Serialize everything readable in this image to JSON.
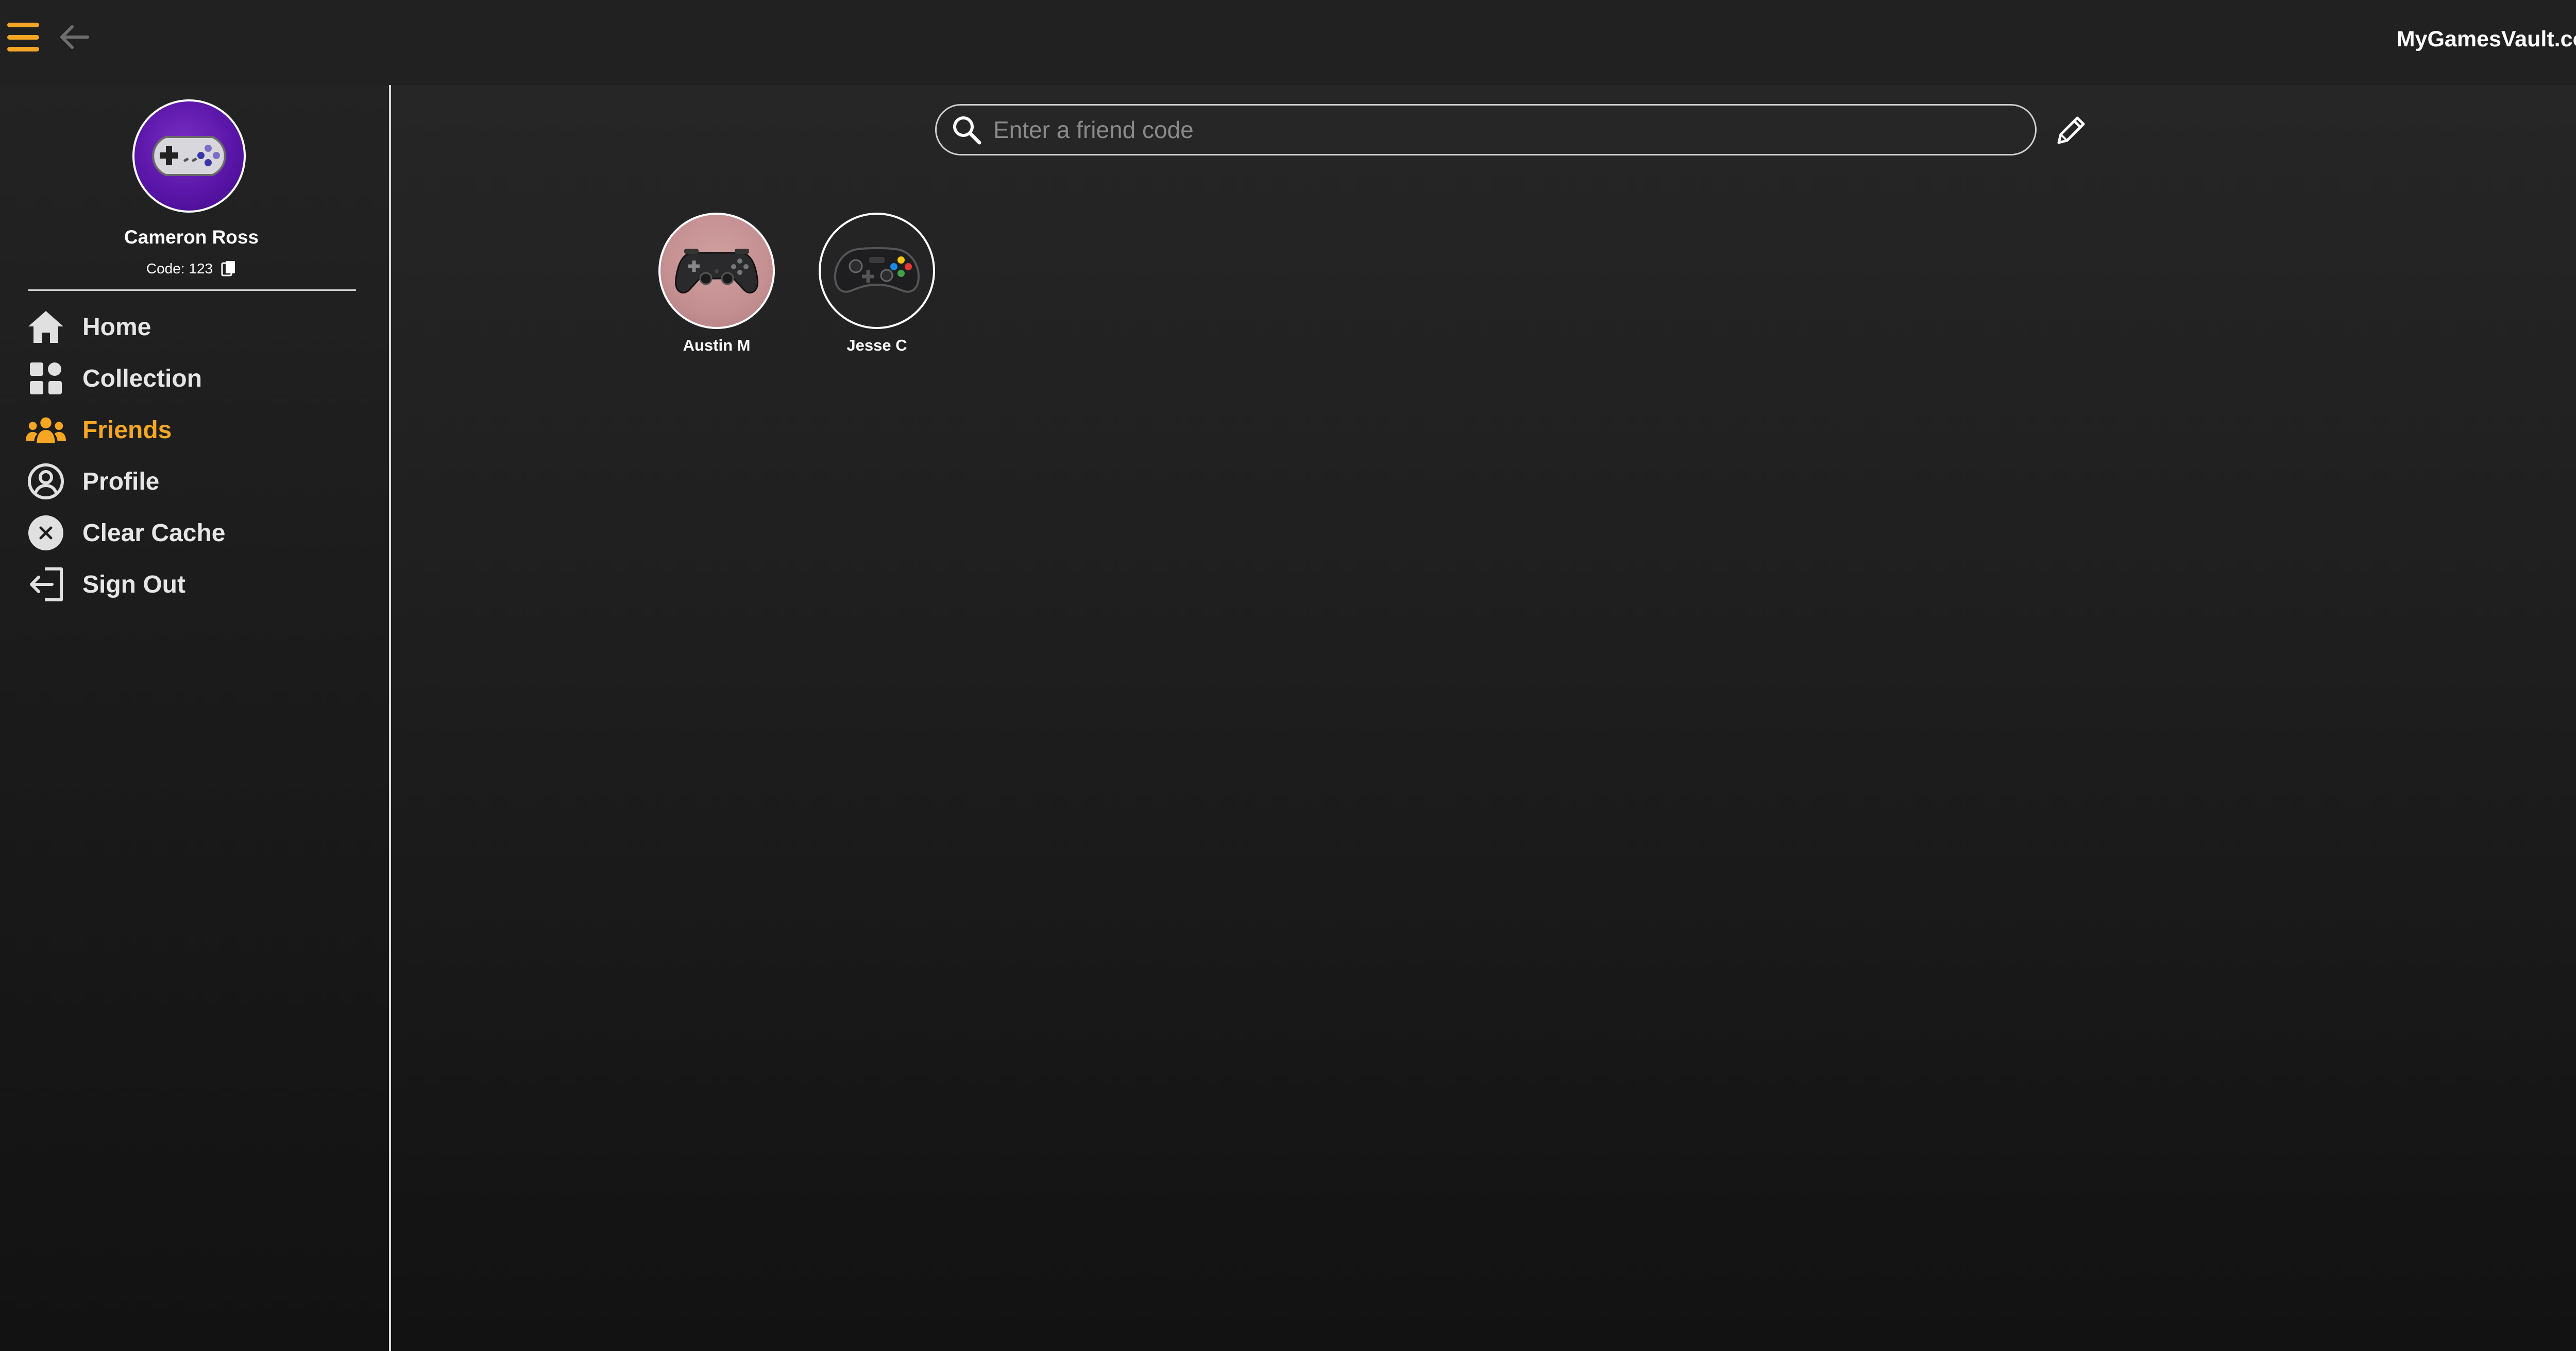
{
  "header": {
    "brand": "MyGamesVault.com",
    "menu_icon": "hamburger-icon",
    "back_icon": "arrow-left-icon",
    "accent_color": "#f5a623"
  },
  "profile": {
    "name": "Cameron Ross",
    "code_label": "Code: 123",
    "avatar_icon": "snes-controller-icon",
    "avatar_bg": "#5a16a8",
    "copy_icon": "copy-icon"
  },
  "nav": {
    "items": [
      {
        "label": "Home",
        "icon": "home-icon",
        "active": false
      },
      {
        "label": "Collection",
        "icon": "grid-icon",
        "active": false
      },
      {
        "label": "Friends",
        "icon": "users-icon",
        "active": true
      },
      {
        "label": "Profile",
        "icon": "user-circle-icon",
        "active": false
      },
      {
        "label": "Clear Cache",
        "icon": "x-circle-icon",
        "active": false
      },
      {
        "label": "Sign Out",
        "icon": "sign-out-icon",
        "active": false
      }
    ]
  },
  "search": {
    "placeholder": "Enter a friend code",
    "value": "",
    "icon": "search-icon",
    "edit_icon": "pencil-icon"
  },
  "friends": [
    {
      "name": "Austin M",
      "avatar_icon": "playstation-controller-icon",
      "avatar_bg": "#c48f90"
    },
    {
      "name": "Jesse C",
      "avatar_icon": "xbox-controller-icon",
      "avatar_bg": "#242424"
    }
  ]
}
